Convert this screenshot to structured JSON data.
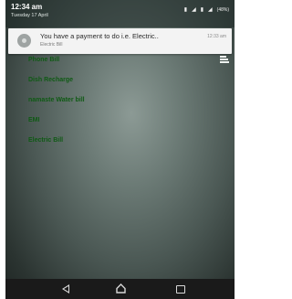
{
  "status_bar": {
    "time": "12:34 am",
    "date": "Tuesday 17 April",
    "battery_percent": "(48%)",
    "icons": [
      "sim-icon",
      "signal-icon",
      "sim-icon",
      "signal-icon"
    ]
  },
  "notification": {
    "title": "You have a payment to do i.e. Electric..",
    "subtitle": "Electric Bill",
    "time": "12:33 am"
  },
  "bills": {
    "items": [
      {
        "label": "Phone Bill"
      },
      {
        "label": "Dish Recharge"
      },
      {
        "label": "namaste Water bill"
      },
      {
        "label": "EMI"
      },
      {
        "label": "Electric Bill"
      }
    ]
  },
  "colors": {
    "bill_text": "#0f5a14",
    "nav_bar": "#1a1a1a",
    "notification_bg": "#f3f3f3"
  }
}
